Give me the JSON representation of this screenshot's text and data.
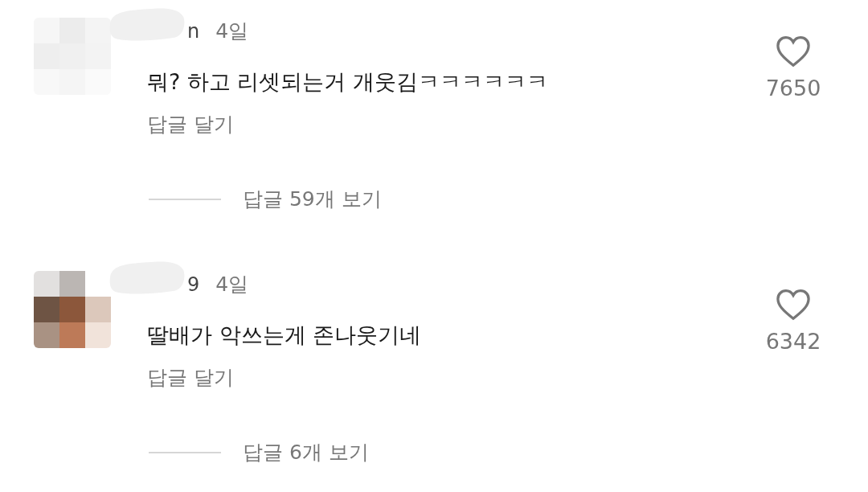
{
  "comments": [
    {
      "username_fragment": "n",
      "time": "4일",
      "text": "뭐? 하고 리셋되는거 개웃김ㅋㅋㅋㅋㅋㅋ",
      "reply_action": "답글 달기",
      "like_count": "7650",
      "liked": false,
      "view_replies": "답글 59개 보기"
    },
    {
      "username_fragment": "9",
      "time": "4일",
      "text": "딸배가 악쓰는게 존나웃기네",
      "reply_action": "답글 달기",
      "like_count": "6342",
      "liked": false,
      "view_replies": "답글 6개 보기"
    }
  ]
}
